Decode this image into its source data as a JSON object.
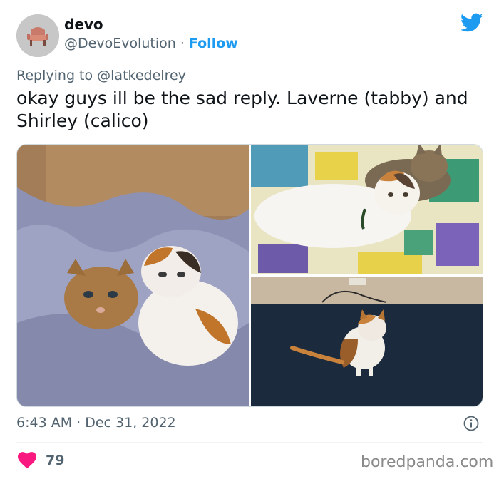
{
  "author": {
    "display_name": "devo",
    "handle": "@DevoEvolution",
    "separator": "·",
    "follow_label": "Follow",
    "avatar_icon": "chair-avatar-icon"
  },
  "brand_icon": "twitter-bird-icon",
  "reply_context": "Replying to @latkedelrey",
  "tweet_text": "okay guys ill be the sad reply. Laverne (tabby) and Shirley (calico)",
  "media": [
    {
      "name": "photo-kittens-in-blanket",
      "description_icon": "image"
    },
    {
      "name": "photo-adult-cats-on-quilt",
      "description_icon": "image"
    },
    {
      "name": "photo-calico-on-carpet",
      "description_icon": "image"
    }
  ],
  "timestamp": "6:43 AM · Dec 31, 2022",
  "likes": {
    "count": "79",
    "icon": "heart-icon"
  },
  "watermark": "boredpanda.com",
  "colors": {
    "accent": "#1d9bf0",
    "heart": "#f91880",
    "secondary_text": "#536471",
    "primary_text": "#0f1419"
  }
}
